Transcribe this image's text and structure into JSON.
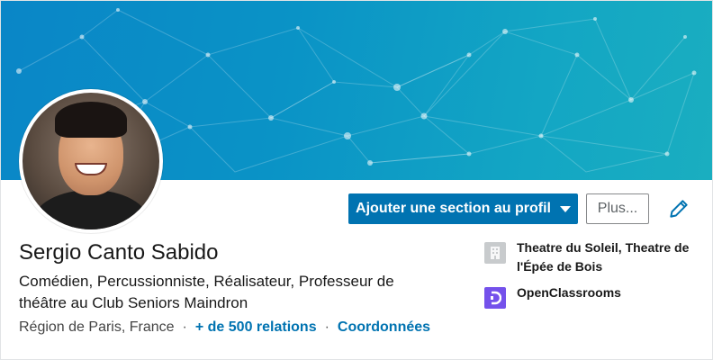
{
  "profile": {
    "name": "Sergio Canto Sabido",
    "headline": "Comédien, Percussionniste, Réalisateur, Professeur de théâtre au Club Seniors Maindron",
    "location": "Région de Paris, France",
    "separator": "·",
    "relations": "+ de 500 relations",
    "contact": "Coordonnées"
  },
  "actions": {
    "add_section_label": "Ajouter une section au profil",
    "more_label": "Plus..."
  },
  "organizations": [
    {
      "name": "Theatre du Soleil, Theatre de l'Épée de Bois",
      "icon": "building-icon"
    },
    {
      "name": "OpenClassrooms",
      "icon": "openclassrooms-logo"
    }
  ],
  "colors": {
    "accent": "#0073b1",
    "openclassrooms": "#7451eb"
  }
}
